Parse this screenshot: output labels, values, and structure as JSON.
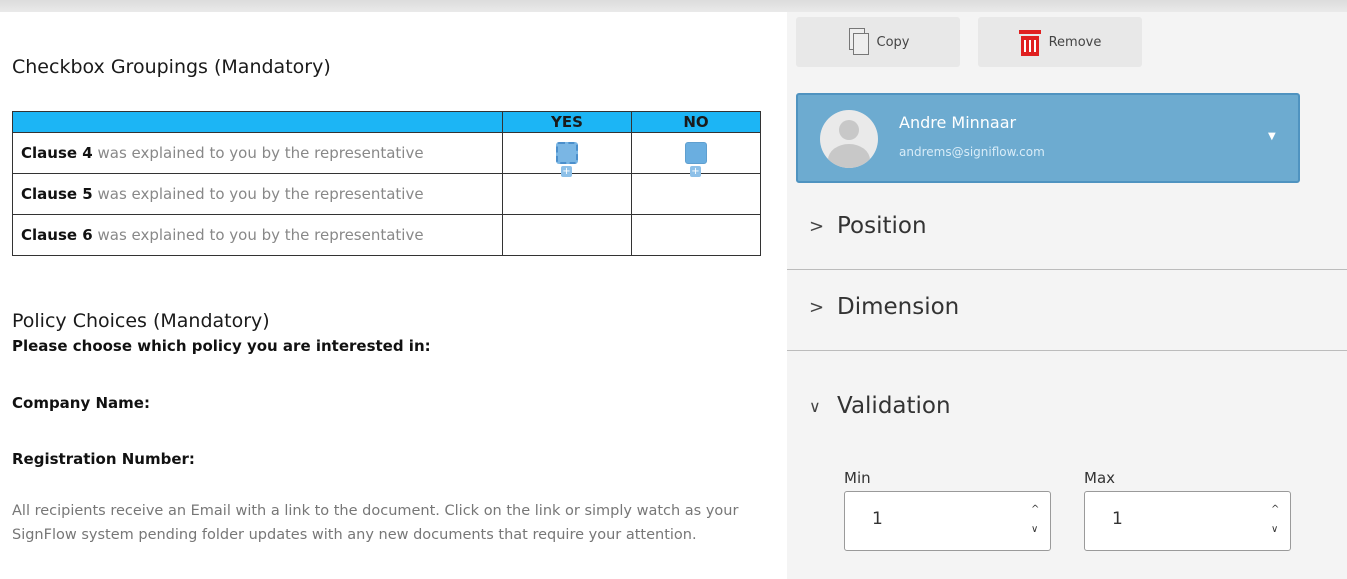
{
  "document": {
    "cut_text": "",
    "checkbox_heading": "Checkbox Groupings (Mandatory)",
    "table": {
      "headers": [
        "",
        "YES",
        "NO"
      ],
      "rows": [
        {
          "bold": "Clause 4",
          "rest": " was explained to you by the representative"
        },
        {
          "bold": "Clause 5",
          "rest": " was explained to you by the representative"
        },
        {
          "bold": "Clause 6",
          "rest": " was explained to you by the representative"
        }
      ]
    },
    "policy_heading": "Policy Choices (Mandatory)",
    "policy_sub": "Please choose which policy you are interested in:",
    "company_label": "Company Name:",
    "registration_label": "Registration Number:",
    "paragraph": "All recipients receive an Email with a link to the document. Click on the link or simply watch as your SignFlow system pending folder updates with any new documents that require your attention."
  },
  "panel": {
    "copy_label": "Copy",
    "remove_label": "Remove",
    "user": {
      "name": "Andre Minnaar",
      "email": "andrems@signiflow.com"
    },
    "sections": {
      "position": "Position",
      "dimension": "Dimension",
      "validation": "Validation"
    },
    "validation": {
      "min_label": "Min",
      "max_label": "Max",
      "min_value": "1",
      "max_value": "1"
    }
  },
  "colors": {
    "accent": "#6dabd0",
    "table_header": "#1cb5f5",
    "remove": "#e02020"
  },
  "icons": [
    "copy-icon",
    "trash-icon",
    "avatar-icon",
    "chevron-right-icon",
    "chevron-down-icon"
  ]
}
